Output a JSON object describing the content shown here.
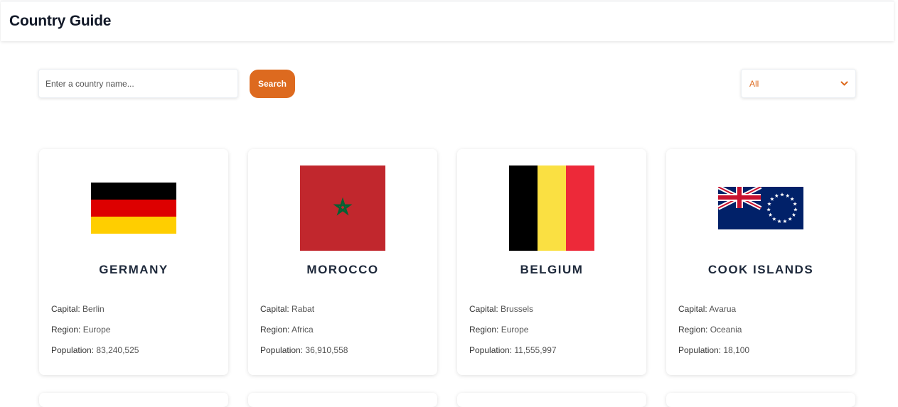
{
  "header": {
    "title": "Country Guide"
  },
  "search": {
    "placeholder": "Enter a country name...",
    "button_label": "Search"
  },
  "filter": {
    "selected": "All"
  },
  "labels": {
    "capital": "Capital:",
    "region": "Region:",
    "population": "Population:"
  },
  "countries": [
    {
      "name": "GERMANY",
      "capital": "Berlin",
      "region": "Europe",
      "population": "83,240,525",
      "flag": "germany-flag"
    },
    {
      "name": "MOROCCO",
      "capital": "Rabat",
      "region": "Africa",
      "population": "36,910,558",
      "flag": "morocco-flag"
    },
    {
      "name": "BELGIUM",
      "capital": "Brussels",
      "region": "Europe",
      "population": "11,555,997",
      "flag": "belgium-flag"
    },
    {
      "name": "COOK ISLANDS",
      "capital": "Avarua",
      "region": "Oceania",
      "population": "18,100",
      "flag": "cook-islands-flag"
    }
  ],
  "colors": {
    "accent": "#dd6a1f",
    "text": "#1e293b"
  }
}
